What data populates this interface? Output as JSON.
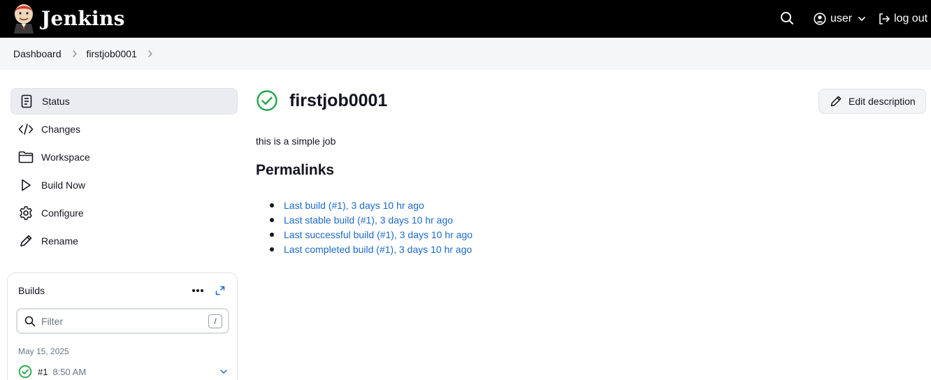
{
  "header": {
    "brand": "Jenkins",
    "user": "user",
    "logout": "log out"
  },
  "breadcrumb": [
    "Dashboard",
    "firstjob0001"
  ],
  "sidenav": [
    {
      "label": "Status",
      "icon": "document-icon",
      "active": true
    },
    {
      "label": "Changes",
      "icon": "code-icon"
    },
    {
      "label": "Workspace",
      "icon": "folder-icon"
    },
    {
      "label": "Build Now",
      "icon": "play-icon"
    },
    {
      "label": "Configure",
      "icon": "gear-icon"
    },
    {
      "label": "Rename",
      "icon": "pencil-icon"
    }
  ],
  "builds": {
    "title": "Builds",
    "filter_placeholder": "Filter",
    "filter_shortcut": "/",
    "date": "May 15, 2025",
    "items": [
      {
        "number": "#1",
        "time": "8:50 AM",
        "status": "success"
      }
    ]
  },
  "main": {
    "title": "firstjob0001",
    "edit_description": "Edit description",
    "description": "this is a simple job",
    "permalinks_heading": "Permalinks",
    "permalinks": [
      "Last build (#1), 3 days 10 hr ago",
      "Last stable build (#1), 3 days 10 hr ago",
      "Last successful build (#1), 3 days 10 hr ago",
      "Last completed build (#1), 3 days 10 hr ago"
    ]
  },
  "colors": {
    "header_bg": "#000000",
    "success": "#1ea64b",
    "link": "#1b6ac9"
  }
}
